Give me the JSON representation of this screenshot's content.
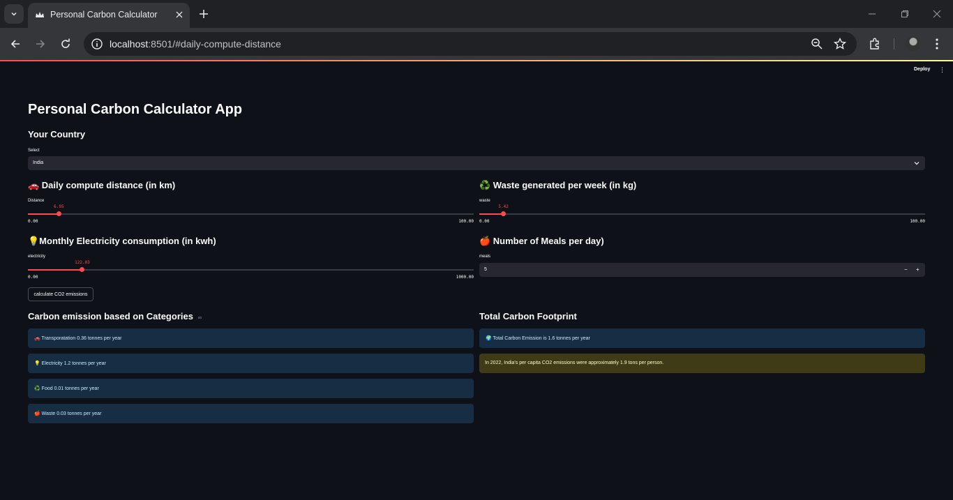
{
  "browser": {
    "tab_title": "Personal Carbon Calculator",
    "url_host": "localhost",
    "url_path": ":8501/#daily-compute-distance"
  },
  "app": {
    "deploy_label": "Deploy",
    "title": "Personal Carbon Calculator App",
    "country": {
      "heading": "Your Country",
      "label": "Select",
      "value": "India"
    },
    "distance": {
      "heading": "🚗 Daily compute distance (in km)",
      "label": "Distance",
      "value": "6.95",
      "min": "0.00",
      "max": "100.00",
      "fraction": 0.0695
    },
    "waste": {
      "heading": "♻️ Waste generated per week (in kg)",
      "label": "waste",
      "value": "5.42",
      "min": "0.00",
      "max": "100.00",
      "fraction": 0.0542
    },
    "electricity": {
      "heading": "💡Monthly Electricity consumption (in kwh)",
      "label": "electricity",
      "value": "122.03",
      "min": "0.00",
      "max": "1000.00",
      "fraction": 0.122
    },
    "meals": {
      "heading": "🍎 Number of Meals per day)",
      "label": "meals",
      "value": "5",
      "minus": "−",
      "plus": "+"
    },
    "calculate_button": "calculate CO2 emissions",
    "categories": {
      "heading": "Carbon emission based on Categories",
      "link_icon": "∞",
      "items": [
        {
          "icon": "🚗",
          "text": "Transporatation 0.36 tonnes per year"
        },
        {
          "icon": "💡",
          "text": "Electricity 1.2 tonnes per year"
        },
        {
          "icon": "♻️",
          "text": "Food 0.01 tonnes per year"
        },
        {
          "icon": "🍎",
          "text": "Waste 0.03 tonnes per year"
        }
      ]
    },
    "total": {
      "heading": "Total Carbon Footprint",
      "icon": "🌍",
      "text": "Total Carbon Emission is 1.6 tonnes per year",
      "note": "In 2022, India's per capita CO2 emissions were approximately 1.9 tons per person."
    }
  }
}
